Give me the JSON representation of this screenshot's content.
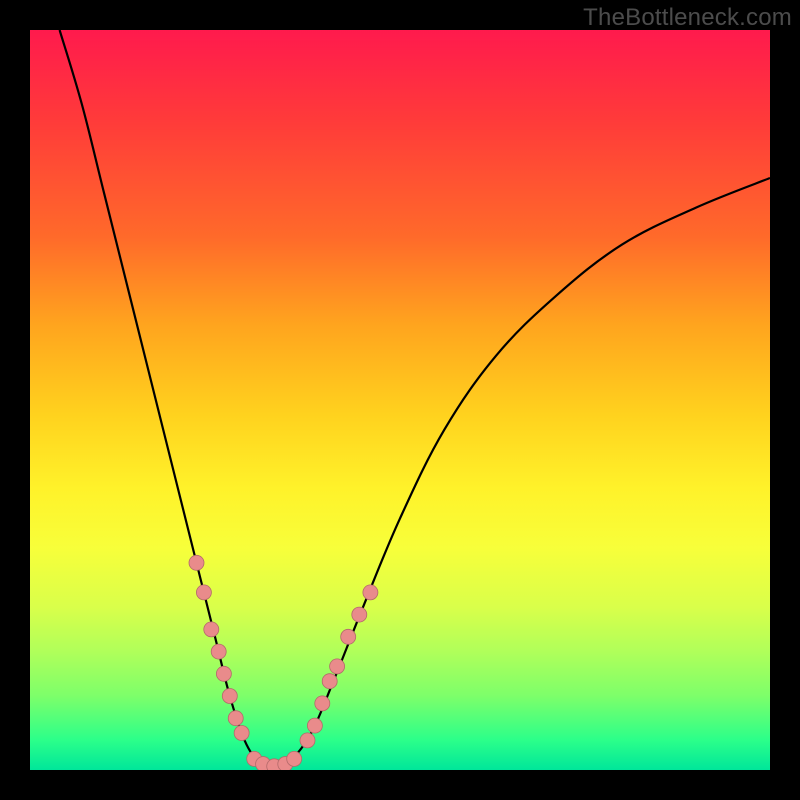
{
  "watermark": "TheBottleneck.com",
  "chart_data": {
    "type": "line",
    "title": "",
    "xlabel": "",
    "ylabel": "",
    "xlim": [
      0,
      100
    ],
    "ylim": [
      0,
      100
    ],
    "grid": false,
    "curve_points": [
      {
        "x": 4,
        "y": 100
      },
      {
        "x": 7,
        "y": 90
      },
      {
        "x": 10,
        "y": 78
      },
      {
        "x": 14,
        "y": 62
      },
      {
        "x": 18,
        "y": 46
      },
      {
        "x": 22,
        "y": 30
      },
      {
        "x": 25,
        "y": 18
      },
      {
        "x": 27,
        "y": 10
      },
      {
        "x": 29,
        "y": 4
      },
      {
        "x": 31,
        "y": 1
      },
      {
        "x": 33,
        "y": 0
      },
      {
        "x": 35,
        "y": 1
      },
      {
        "x": 38,
        "y": 5
      },
      {
        "x": 41,
        "y": 12
      },
      {
        "x": 45,
        "y": 22
      },
      {
        "x": 50,
        "y": 34
      },
      {
        "x": 56,
        "y": 46
      },
      {
        "x": 63,
        "y": 56
      },
      {
        "x": 71,
        "y": 64
      },
      {
        "x": 80,
        "y": 71
      },
      {
        "x": 90,
        "y": 76
      },
      {
        "x": 100,
        "y": 80
      }
    ],
    "marker_points": [
      {
        "x": 22.5,
        "y": 28
      },
      {
        "x": 23.5,
        "y": 24
      },
      {
        "x": 24.5,
        "y": 19
      },
      {
        "x": 25.5,
        "y": 16
      },
      {
        "x": 26.2,
        "y": 13
      },
      {
        "x": 27.0,
        "y": 10
      },
      {
        "x": 27.8,
        "y": 7
      },
      {
        "x": 28.6,
        "y": 5
      },
      {
        "x": 30.3,
        "y": 1.5
      },
      {
        "x": 31.5,
        "y": 0.8
      },
      {
        "x": 33.0,
        "y": 0.5
      },
      {
        "x": 34.5,
        "y": 0.8
      },
      {
        "x": 35.7,
        "y": 1.5
      },
      {
        "x": 37.5,
        "y": 4
      },
      {
        "x": 38.5,
        "y": 6
      },
      {
        "x": 39.5,
        "y": 9
      },
      {
        "x": 40.5,
        "y": 12
      },
      {
        "x": 41.5,
        "y": 14
      },
      {
        "x": 43.0,
        "y": 18
      },
      {
        "x": 44.5,
        "y": 21
      },
      {
        "x": 46.0,
        "y": 24
      }
    ]
  }
}
